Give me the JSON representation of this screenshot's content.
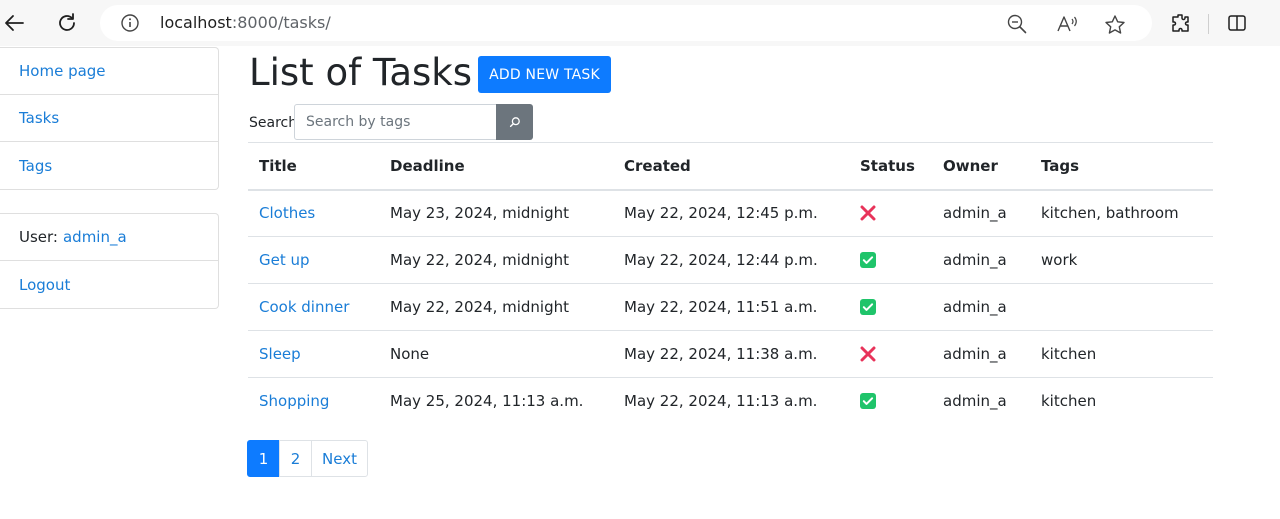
{
  "browser": {
    "url_host": "localhost",
    "url_rest": ":8000/tasks/"
  },
  "sidebar": {
    "nav": [
      {
        "label": "Home page"
      },
      {
        "label": "Tasks"
      },
      {
        "label": "Tags"
      }
    ],
    "user_label": "User:",
    "username": "admin_a",
    "logout": "Logout"
  },
  "main": {
    "title": "List of Tasks",
    "add_button": "ADD NEW TASK",
    "search_label": "Search",
    "search_placeholder": "Search by tags",
    "columns": [
      "Title",
      "Deadline",
      "Created",
      "Status",
      "Owner",
      "Tags"
    ],
    "rows": [
      {
        "title": "Clothes",
        "deadline": "May 23, 2024, midnight",
        "created": "May 22, 2024, 12:45 p.m.",
        "status": "not-done",
        "owner": "admin_a",
        "tags": "kitchen, bathroom"
      },
      {
        "title": "Get up",
        "deadline": "May 22, 2024, midnight",
        "created": "May 22, 2024, 12:44 p.m.",
        "status": "done",
        "owner": "admin_a",
        "tags": "work"
      },
      {
        "title": "Cook dinner",
        "deadline": "May 22, 2024, midnight",
        "created": "May 22, 2024, 11:51 a.m.",
        "status": "done",
        "owner": "admin_a",
        "tags": ""
      },
      {
        "title": "Sleep",
        "deadline": "None",
        "created": "May 22, 2024, 11:38 a.m.",
        "status": "not-done",
        "owner": "admin_a",
        "tags": "kitchen"
      },
      {
        "title": "Shopping",
        "deadline": "May 25, 2024, 11:13 a.m.",
        "created": "May 22, 2024, 11:13 a.m.",
        "status": "done",
        "owner": "admin_a",
        "tags": "kitchen"
      }
    ],
    "pagination": {
      "pages": [
        "1",
        "2"
      ],
      "current": "1",
      "next": "Next"
    }
  },
  "colors": {
    "primary": "#0d7bff",
    "link": "#1a7dd7",
    "done": "#1fc46a",
    "not_done": "#e8335a",
    "secondary": "#6c757d"
  }
}
